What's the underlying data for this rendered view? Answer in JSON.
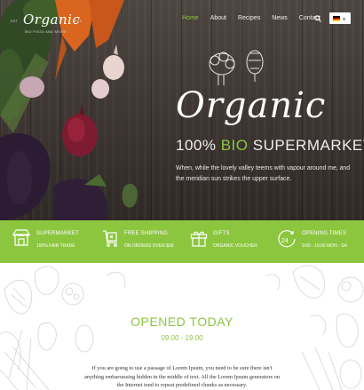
{
  "header": {
    "logo": {
      "word": "Organic",
      "left_text": "EST",
      "right_text": "2015",
      "tagline": "BIO FOOD AND MORE"
    },
    "nav": [
      {
        "label": "Home",
        "active": true
      },
      {
        "label": "About",
        "active": false
      },
      {
        "label": "Recipes",
        "active": false
      },
      {
        "label": "News",
        "active": false
      },
      {
        "label": "Contact",
        "active": false
      }
    ],
    "search_icon": "search-icon",
    "language_flag": "german-flag"
  },
  "hero": {
    "title": "Organic",
    "tag_prefix": "100%",
    "tag_accent": "BIO",
    "tag_suffix": "SUPERMARKET",
    "description": "When, while the lovely valley teems with vapour around me, and the meridian sun strikes the upper surface."
  },
  "features": [
    {
      "icon": "market-stall-icon",
      "title": "SUPERMARKET",
      "subtitle": "100% FAIR TRADE"
    },
    {
      "icon": "shipping-box-icon",
      "title": "FREE SHIPPING",
      "subtitle": "ON ORDERS OVER $99"
    },
    {
      "icon": "gift-icon",
      "title": "GIFTS",
      "subtitle": "ORGANIC VOUCHER"
    },
    {
      "icon": "clock-24-icon",
      "title": "OPENING TIMES",
      "subtitle": "9:00 - 19:00 MON - SA"
    }
  ],
  "opened": {
    "title": "OPENED TODAY",
    "hours": "09.00 - 19.00",
    "text": "If you are going to use a passage of Lorem Ipsum, you need to be sure there isn't anything embarrassing hidden in the middle of text. All the Lorem Ipsum generators on the Internet tend to repeat predefined chunks as necessary."
  },
  "colors": {
    "accent": "#8cc63f",
    "hero_bg": "#3c3531",
    "flag": [
      "#000000",
      "#dd0000",
      "#ffce00"
    ]
  }
}
